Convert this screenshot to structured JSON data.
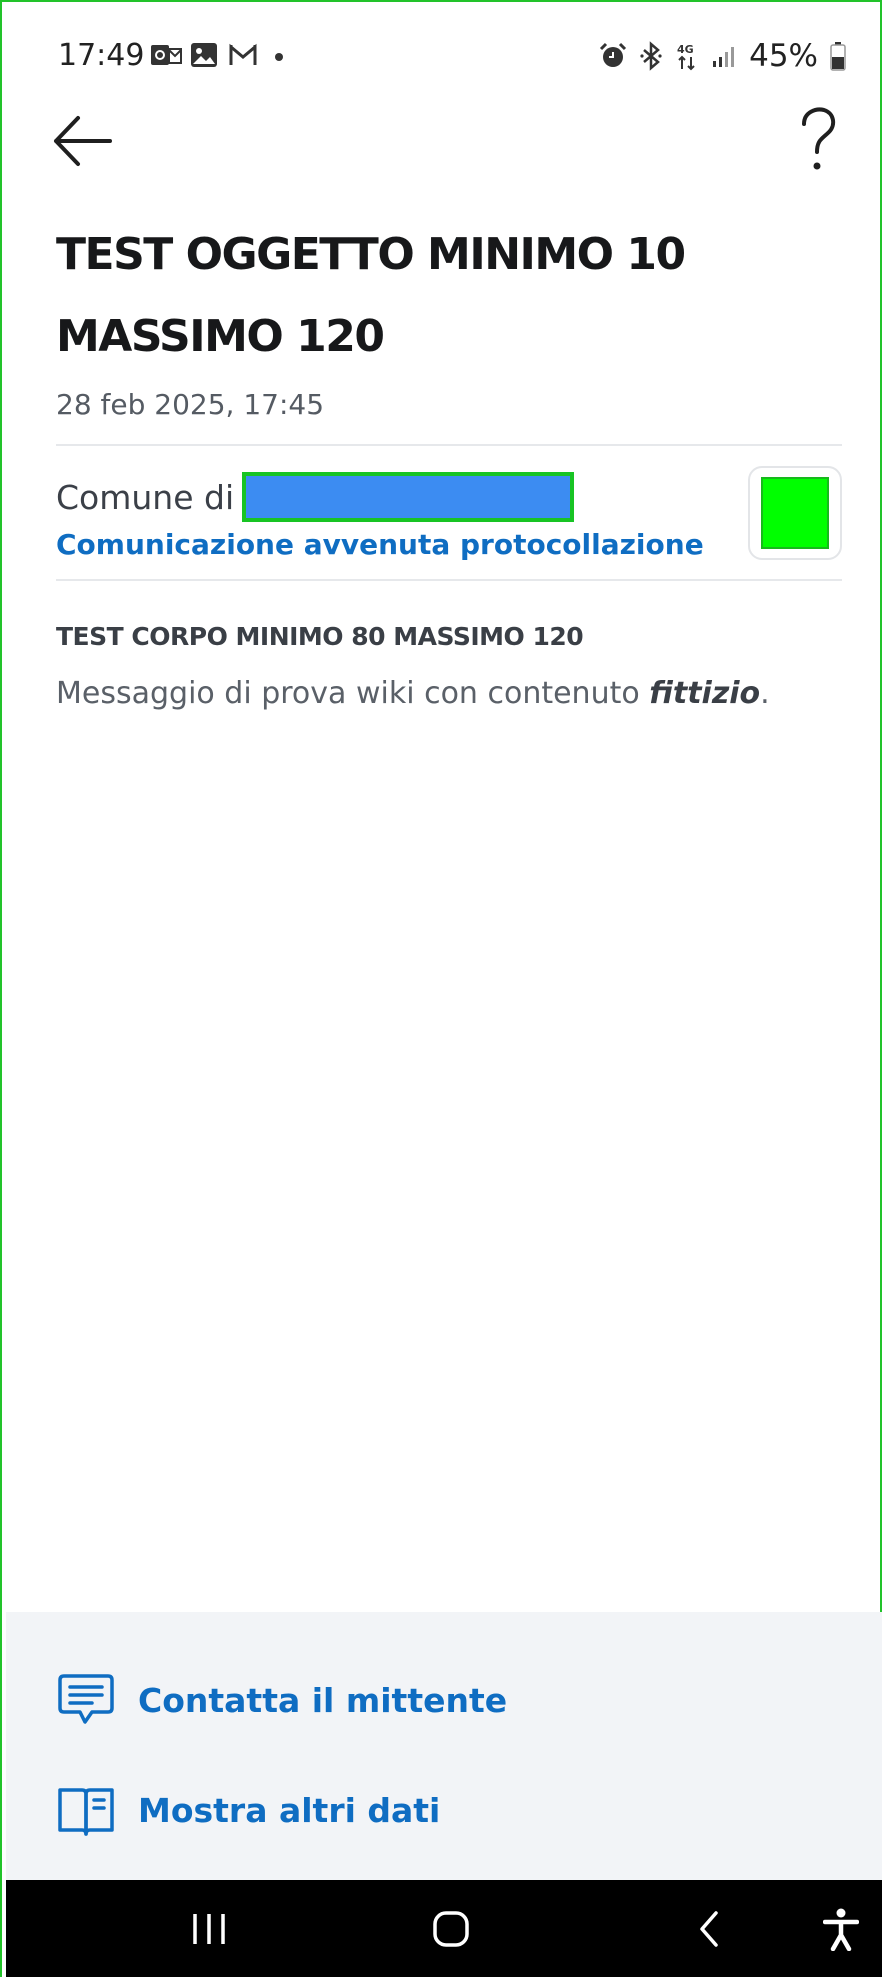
{
  "status_bar": {
    "time": "17:49",
    "battery": "45%",
    "left_icons": [
      "outlook-icon",
      "gallery-icon",
      "gmail-icon",
      "notification-dot-icon"
    ],
    "right_icons": [
      "alarm-icon",
      "bluetooth-icon",
      "4g-icon",
      "signal-icon",
      "battery-icon"
    ]
  },
  "app_bar": {
    "back_icon": "arrow-left-icon",
    "help_label": "?"
  },
  "message": {
    "title": "TEST OGGETTO MINIMO 10 MASSIMO 120",
    "date": "28 feb 2025, 17:45",
    "sender_prefix": "Comune di",
    "sender_category": "Comunicazione avvenuta protocollazione",
    "body_title": "TEST CORPO MINIMO 80 MASSIMO 120",
    "body_text_prefix": "Messaggio di prova wiki con contenuto ",
    "body_text_emphasis": "fittizio",
    "body_text_suffix": "."
  },
  "actions": {
    "contact_label": "Contatta il mittente",
    "contact_icon": "chat-icon",
    "more_data_label": "Mostra altri dati",
    "more_data_icon": "book-icon"
  },
  "nav_bar": {
    "buttons": [
      "recents-icon",
      "home-icon",
      "back-icon",
      "accessibility-icon"
    ]
  },
  "colors": {
    "accent": "#0f6dc2",
    "redaction": "#3c8cf2",
    "logo_placeholder": "#00ff00",
    "panel_bg": "#f2f4f7"
  }
}
